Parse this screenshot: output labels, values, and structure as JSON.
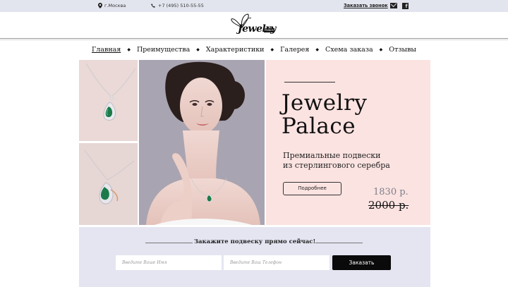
{
  "topbar": {
    "location": "г.Москва",
    "phone": "+7 (495) 510-55-55",
    "callback": "Заказать звонок",
    "icons": [
      "location-pin-icon",
      "phone-icon",
      "mail-icon",
      "facebook-icon"
    ]
  },
  "logo": {
    "word": "Jewelry",
    "sub": "Palace"
  },
  "nav": {
    "items": [
      {
        "label": "Главная",
        "active": true
      },
      {
        "label": "Преимущества"
      },
      {
        "label": "Характеристики"
      },
      {
        "label": "Галерея"
      },
      {
        "label": "Схема заказа"
      },
      {
        "label": "Отзывы"
      }
    ],
    "separator": "◆"
  },
  "hero": {
    "title_line1": "Jewelry",
    "title_line2": "Palace",
    "desc_line1": "Премиальные подвески",
    "desc_line2": "из стерлингового серебра",
    "button": "Подробнее",
    "price_new": "1830 р.",
    "price_old": "2000 р.",
    "colors": {
      "panel": "#fbe3e1",
      "gem": "#1b7a4a"
    }
  },
  "order": {
    "heading": "Закажите подвеску прямо сейчас!",
    "name_placeholder": "Введите Ваше Имя",
    "phone_placeholder": "Введите Ваш Телефон",
    "submit": "Заказать"
  }
}
